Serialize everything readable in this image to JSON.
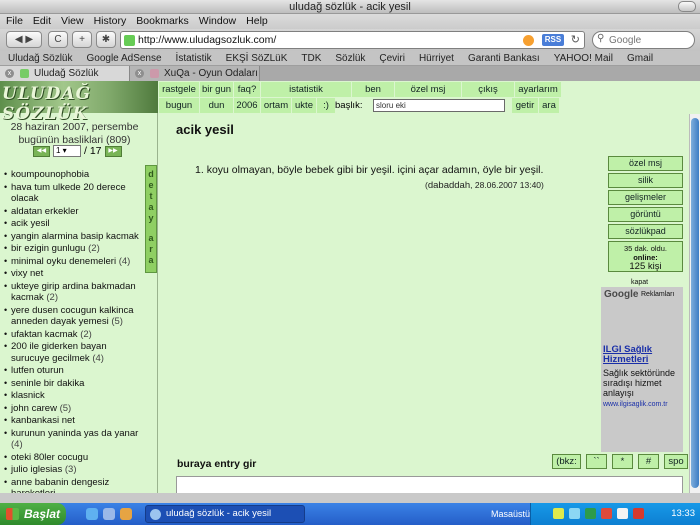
{
  "window": {
    "title": "uludağ sözlük - acik yesil"
  },
  "menubar": [
    "File",
    "Edit",
    "View",
    "History",
    "Bookmarks",
    "Window",
    "Help"
  ],
  "toolbar": {
    "back": "◀ ▶",
    "reload": "C",
    "add": "+",
    "url": "http://www.uludagsozluk.com/",
    "rss": "RSS",
    "search_placeholder": "Google"
  },
  "bookmarks": [
    "Uludağ Sözlük",
    "Google AdSense",
    "İstatistik",
    "EKŞİ SöZLüK",
    "TDK",
    "Sözlük",
    "Çeviri",
    "Hürriyet",
    "Garanti Bankası",
    "YAHOO! Mail",
    "Gmail"
  ],
  "tabs": [
    {
      "label": "Uludağ Sözlük"
    },
    {
      "label": "XuQa - Oyun Odaları"
    }
  ],
  "site": {
    "logo": "ULUDAĞ SÖZLÜK",
    "date_line": "28 haziran 2007, persembe",
    "count_line": "bugünün basliklari (809)",
    "pager": {
      "page": "1",
      "total": "/ 17"
    },
    "detay_letters": [
      "d",
      "e",
      "t",
      "a",
      "y"
    ],
    "ara_letters": [
      "a",
      "r",
      "a"
    ],
    "topics": [
      {
        "t": "koumpounophobia",
        "c": ""
      },
      {
        "t": "hava tum ulkede 20 derece olacak",
        "c": ""
      },
      {
        "t": "aldatan erkekler",
        "c": ""
      },
      {
        "t": "acik yesil",
        "c": ""
      },
      {
        "t": "yangin alarmina basip kacmak",
        "c": ""
      },
      {
        "t": "bir ezigin gunlugu",
        "c": "(2)"
      },
      {
        "t": "minimal oyku denemeleri",
        "c": "(4)"
      },
      {
        "t": "vixy net",
        "c": ""
      },
      {
        "t": "ukteye girip ardina bakmadan kacmak",
        "c": "(2)"
      },
      {
        "t": "yere dusen cocugun kalkinca anneden dayak yemesi",
        "c": "(5)"
      },
      {
        "t": "ufaktan kacmak",
        "c": "(2)"
      },
      {
        "t": "200 ile giderken bayan surucuye gecilmek",
        "c": "(4)"
      },
      {
        "t": "lutfen oturun",
        "c": ""
      },
      {
        "t": "seninle bir dakika",
        "c": ""
      },
      {
        "t": "klasnick",
        "c": ""
      },
      {
        "t": "john carew",
        "c": "(5)"
      },
      {
        "t": "kanbankasi net",
        "c": ""
      },
      {
        "t": "kurunun yaninda yas da yanar",
        "c": "(4)"
      },
      {
        "t": "oteki 80ler cocugu",
        "c": ""
      },
      {
        "t": "julio iglesias",
        "c": "(3)"
      },
      {
        "t": "anne babanin dengesiz hareketleri",
        "c": ""
      },
      {
        "t": "hata yapmaktan korkmak",
        "c": "(11)"
      }
    ]
  },
  "nav": {
    "row1": [
      "rastgele",
      "bir gun",
      "faq?",
      "istatistik",
      "ben",
      "özel msj",
      "çıkış",
      "ayarlarım"
    ],
    "row2": [
      "bugun",
      "dun",
      "2006",
      "ortam",
      "ukte",
      ":)"
    ],
    "baslik_label": "başlık:",
    "baslik_value": "sloru eki",
    "getir": "getir",
    "ara": "ara"
  },
  "main": {
    "title": "acik yesil",
    "entry_number": "1.",
    "entry_text": "koyu olmayan, böyle bebek gibi bir yeşil. içini açar adamın, öyle bir yeşil.",
    "entry_author": "dabaddah",
    "entry_date": ", 28.06.2007 13:40)",
    "entry_open": "(",
    "right_menu": [
      "özel msj",
      "silik",
      "gelişmeler",
      "görüntü",
      "sözlükpad"
    ],
    "online": {
      "line1": "35 dak. oldu.",
      "label": "online:",
      "count": "125 kişi"
    },
    "ad": {
      "kapat": "kapat",
      "google": "Google",
      "reklam": "Reklamları",
      "title": "ILGI Sağlık Hizmetleri",
      "text": "Sağlık sektöründe sıradışı hizmet anlayışı",
      "url": "www.ilgisaglik.com.tr"
    },
    "entry_box_label": "buraya entry gir",
    "tool_buttons": [
      "(bkz:",
      "``",
      "*",
      "#",
      "spo"
    ]
  },
  "taskbar": {
    "start": "Başlat",
    "window": "uludağ sözlük - acik yesil",
    "desktop": "Masaüstü",
    "clock": "13:33"
  }
}
